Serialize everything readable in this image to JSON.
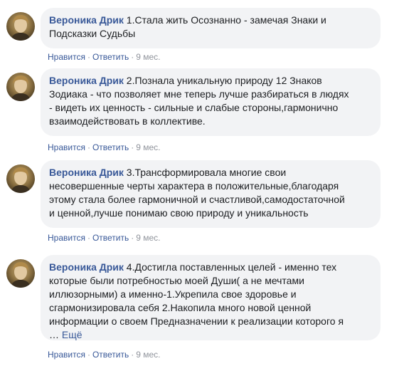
{
  "comments": [
    {
      "author": "Вероника Дрик",
      "lines": [
        "1.Стала жить Осознанно - замечая Знаки и",
        "Подсказки Судьбы"
      ],
      "more": "",
      "like_label": "Нравится",
      "reply_label": "Ответить",
      "time": "9 мес."
    },
    {
      "author": "Вероника Дрик",
      "lines": [
        "2.Познала уникальную природу 12 Знаков",
        "Зодиака - что позволяет мне теперь лучше разбираться в людях",
        "- видеть их ценность - сильные и слабые стороны,гармонично",
        "взаимодействовать в коллективе."
      ],
      "more": "",
      "like_label": "Нравится",
      "reply_label": "Ответить",
      "time": "9 мес."
    },
    {
      "author": "Вероника Дрик",
      "lines": [
        "3.Трансформировала многие свои",
        "несовершенные черты характера в положительные,благодаря",
        "этому стала более гармоничной и счастливой,самодостаточной",
        "и ценной,лучше понимаю свою природу и уникальность"
      ],
      "more": "",
      "like_label": "Нравится",
      "reply_label": "Ответить",
      "time": "9 мес."
    },
    {
      "author": "Вероника Дрик",
      "lines": [
        "4.Достигла поставленных целей - именно тех",
        "которые были потребностью моей Души( а не мечтами",
        "иллюзорными) а именно-1.Укрепила свое здоровье и",
        "сгармонизировала себя 2.Накопила много новой ценной",
        "информации о своем Предназначении к реализации которого я"
      ],
      "more": "Ещё",
      "like_label": "Нравится",
      "reply_label": "Ответить",
      "time": "9 мес."
    }
  ],
  "separator": "·",
  "colors": {
    "link": "#385898",
    "meta": "#90949c",
    "bubble": "#f2f3f5",
    "text": "#1c1e21"
  },
  "icons": {
    "avatar": "profile-photo"
  }
}
